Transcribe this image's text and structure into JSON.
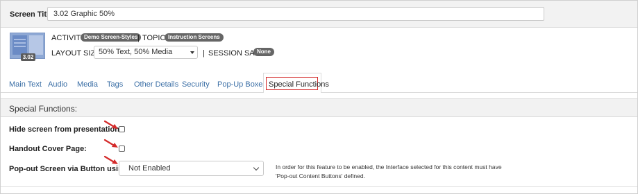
{
  "screen_title": {
    "label": "Screen Title",
    "value": "3.02 Graphic 50%"
  },
  "screen_info": {
    "thumbnail_badge": "3.02",
    "activity_label": "ACTIVITY:",
    "activity_value": "Demo Screen-Styles",
    "separator": "|",
    "topic_label": "TOPIC:",
    "topic_value": "Instruction Screens",
    "layout_label": "LAYOUT SIZE:",
    "layout_value": "50% Text, 50% Media",
    "session_label": "SESSION SAVE:",
    "session_value": "None"
  },
  "tabs": [
    {
      "label": "Main Text",
      "active": false
    },
    {
      "label": "Audio",
      "active": false
    },
    {
      "label": "Media",
      "active": false
    },
    {
      "label": "Tags",
      "active": false
    },
    {
      "label": "Other Details",
      "active": false
    },
    {
      "label": "Security",
      "active": false
    },
    {
      "label": "Pop-Up Boxes",
      "active": false
    },
    {
      "label": "Special Functions",
      "active": true
    }
  ],
  "section": {
    "title": "Special Functions:",
    "hide_screen_label": "Hide screen from presentation:",
    "hide_screen_checked": false,
    "handout_label": "Handout Cover Page:",
    "handout_checked": false,
    "popout_label": "Pop-out Screen via Button using:",
    "popout_value": "Not Enabled",
    "popout_help": "In order for this feature to be enabled, the Interface selected for this content must have 'Pop-out Content Buttons' defined."
  },
  "colors": {
    "tab_link": "#3a6ea5",
    "highlight_red": "#d42a2a",
    "pill_bg": "#666666",
    "header_bg": "#f2f2f2"
  },
  "icons": {
    "layout_dropdown": "caret-down-icon",
    "popout_dropdown": "chevron-down-icon",
    "annotation": "red-arrow-icon"
  }
}
